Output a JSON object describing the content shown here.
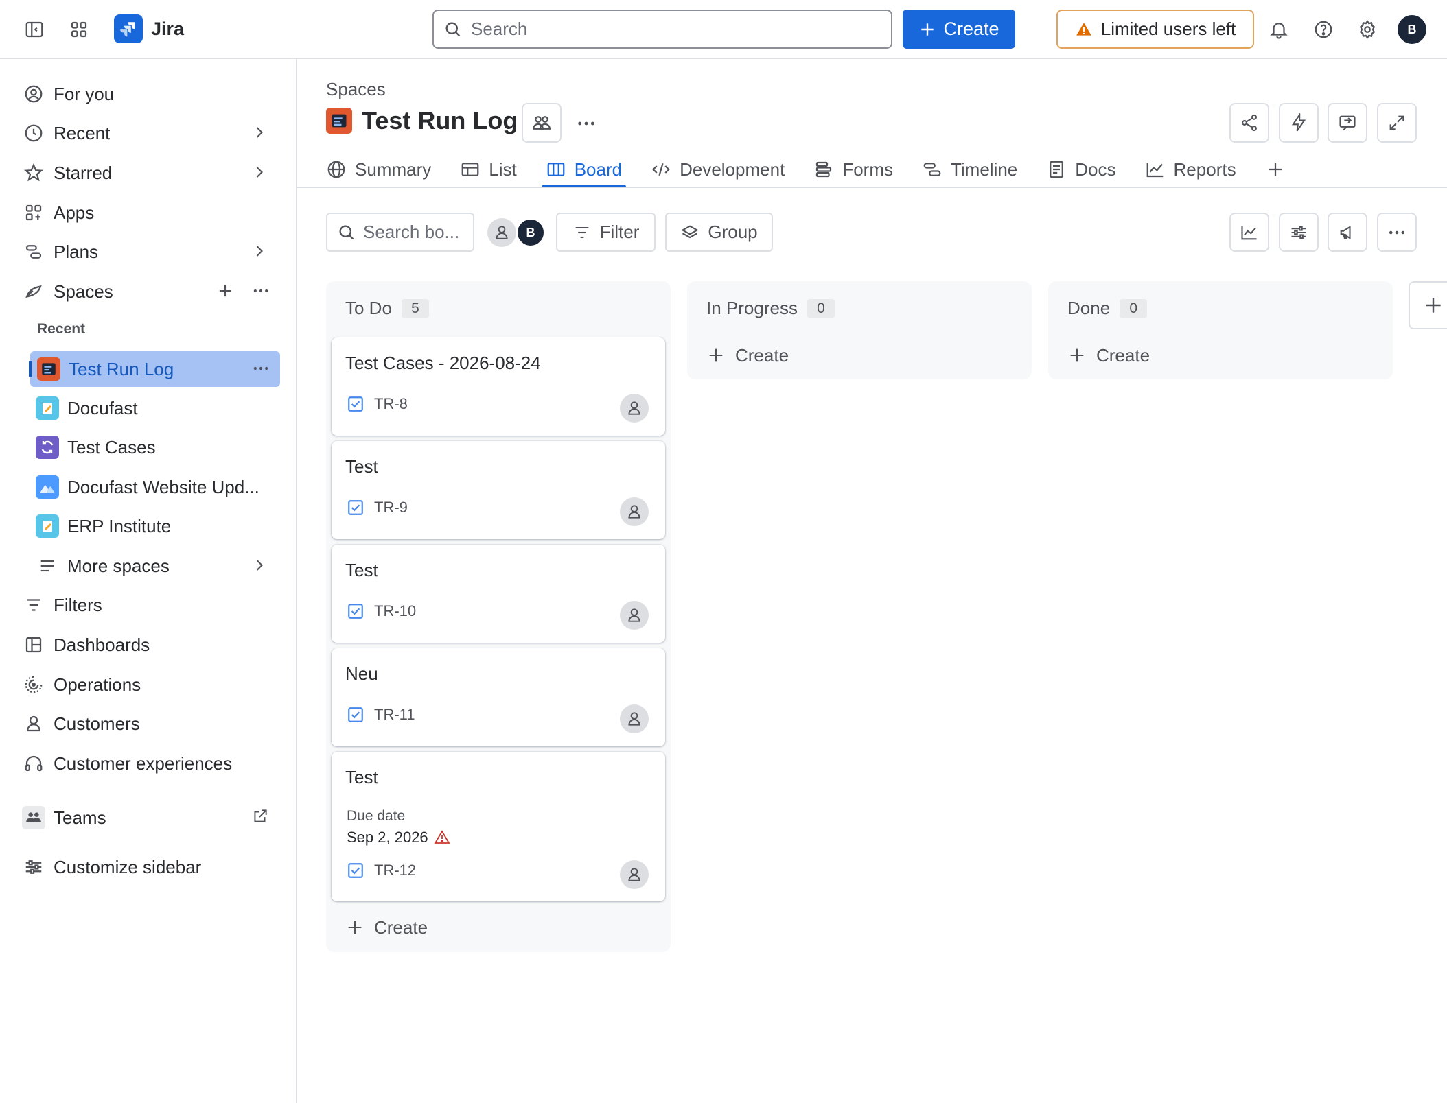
{
  "topbar": {
    "app_name": "Jira",
    "search_placeholder": "Search",
    "create_label": "Create",
    "limited_label": "Limited users left",
    "avatar_initial": "B"
  },
  "sidebar": {
    "items_top": [
      {
        "label": "For you",
        "icon": "person-circle-icon"
      },
      {
        "label": "Recent",
        "icon": "clock-icon"
      },
      {
        "label": "Starred",
        "icon": "star-icon"
      },
      {
        "label": "Apps",
        "icon": "apps-icon"
      },
      {
        "label": "Plans",
        "icon": "plans-icon"
      },
      {
        "label": "Spaces",
        "icon": "spaces-icon"
      }
    ],
    "recent_heading": "Recent",
    "spaces": [
      {
        "label": "Test Run Log"
      },
      {
        "label": "Docufast"
      },
      {
        "label": "Test Cases"
      },
      {
        "label": "Docufast Website Upd..."
      },
      {
        "label": "ERP Institute"
      },
      {
        "label": "More spaces"
      }
    ],
    "items_bottom": [
      {
        "label": "Filters",
        "icon": "filter-icon"
      },
      {
        "label": "Dashboards",
        "icon": "dashboard-icon"
      },
      {
        "label": "Operations",
        "icon": "operations-icon"
      },
      {
        "label": "Customers",
        "icon": "person-icon"
      },
      {
        "label": "Customer experiences",
        "icon": "headset-icon"
      },
      {
        "label": "Teams",
        "icon": "teams-icon"
      },
      {
        "label": "Customize sidebar",
        "icon": "customize-icon"
      }
    ]
  },
  "header": {
    "breadcrumb": "Spaces",
    "title": "Test Run Log",
    "tabs": [
      "Summary",
      "List",
      "Board",
      "Development",
      "Forms",
      "Timeline",
      "Docs",
      "Reports"
    ],
    "active_tab": "Board"
  },
  "toolbar": {
    "search_placeholder": "Search bo...",
    "avatar_initial": "B",
    "filter_label": "Filter",
    "group_label": "Group"
  },
  "board": {
    "columns": [
      {
        "name": "To Do",
        "count": "5",
        "cards": [
          {
            "title": "Test Cases - 2026-08-24",
            "key": "TR-8"
          },
          {
            "title": "Test",
            "key": "TR-9"
          },
          {
            "title": "Test",
            "key": "TR-10"
          },
          {
            "title": "Neu",
            "key": "TR-11"
          },
          {
            "title": "Test",
            "key": "TR-12",
            "due_label": "Due date",
            "due_date": "Sep 2, 2026"
          }
        ],
        "create_label": "Create"
      },
      {
        "name": "In Progress",
        "count": "0",
        "cards": [],
        "create_label": "Create"
      },
      {
        "name": "Done",
        "count": "0",
        "cards": [],
        "create_label": "Create"
      }
    ]
  },
  "colors": {
    "brand_blue": "#1868db",
    "selected_bg": "#a6c1f3",
    "warning_orange": "#e2a35c",
    "overdue_red": "#c9372c"
  }
}
